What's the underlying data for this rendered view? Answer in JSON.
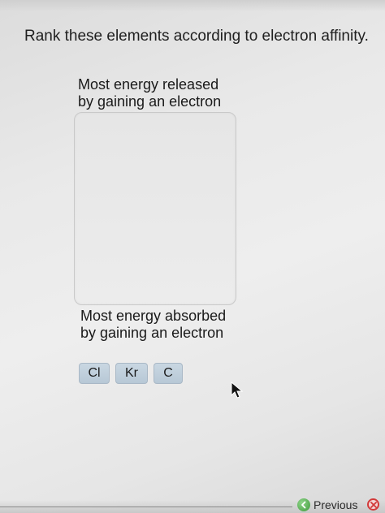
{
  "question": {
    "text": "Rank these elements according to electron affinity."
  },
  "ranking": {
    "top_label_line1": "Most energy released",
    "top_label_line2": "by gaining an electron",
    "bottom_label_line1": "Most energy absorbed",
    "bottom_label_line2": "by gaining an electron"
  },
  "elements": [
    {
      "symbol": "Cl"
    },
    {
      "symbol": "Kr"
    },
    {
      "symbol": "C"
    }
  ],
  "navigation": {
    "previous_label": "Previous",
    "previous_icon": "back-arrow-icon",
    "close_icon": "close-icon"
  },
  "colors": {
    "chip_fill": "#c1d0dc",
    "chip_border": "#a9b8c6",
    "previous_icon": "#4caf50",
    "close_icon": "#d23a3a"
  }
}
